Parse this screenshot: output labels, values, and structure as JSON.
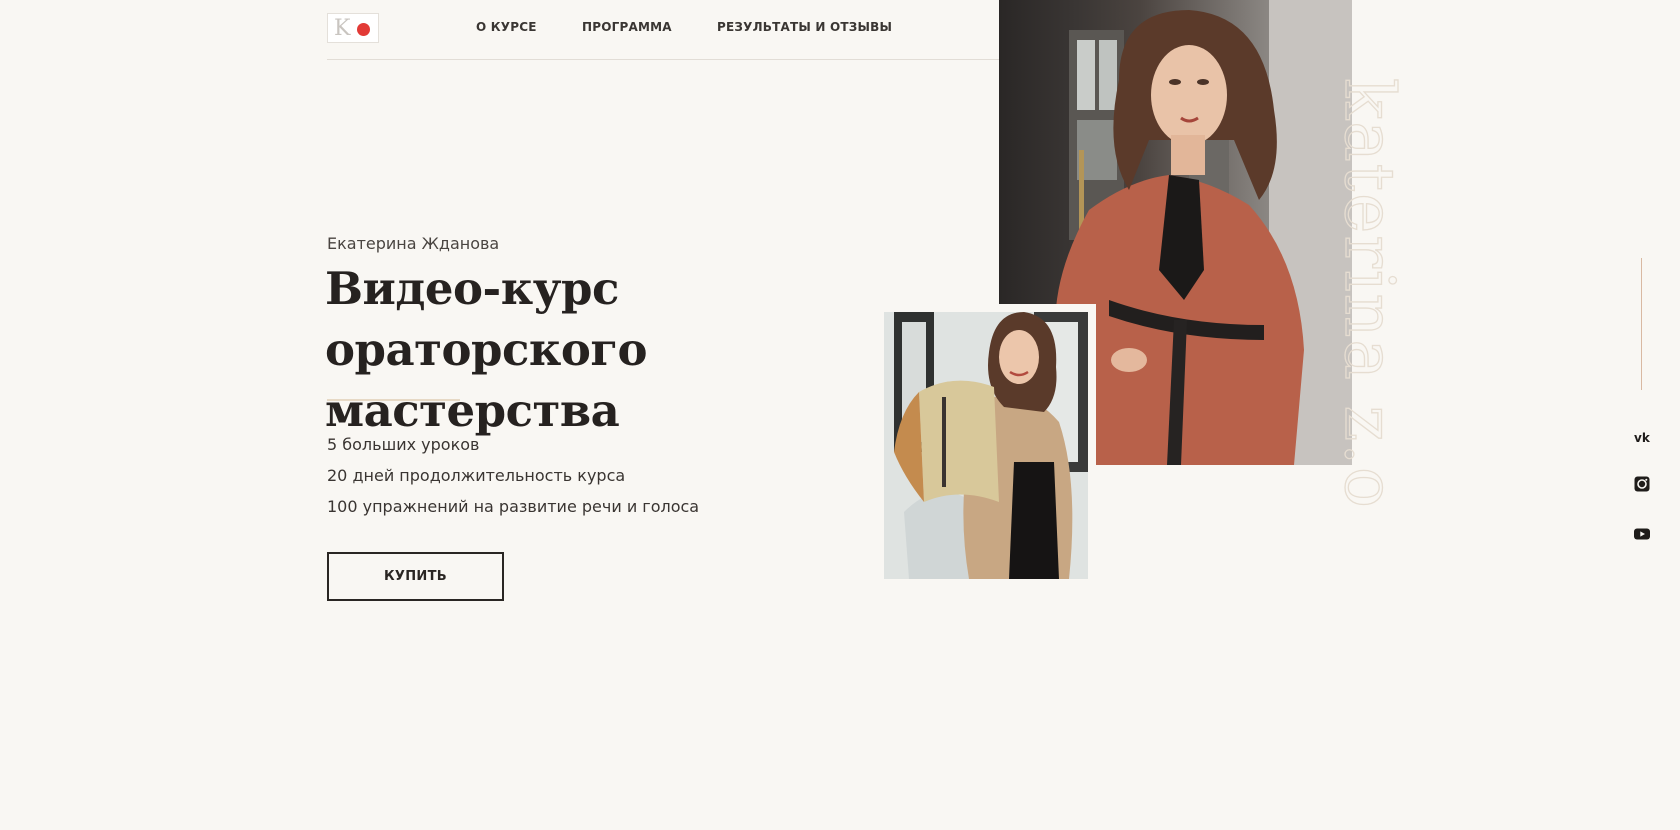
{
  "header": {
    "logo_alt": "КЖ",
    "nav": [
      {
        "label": "О КУРСЕ"
      },
      {
        "label": "ПРОГРАММА"
      },
      {
        "label": "РЕЗУЛЬТАТЫ И ОТЗЫВЫ"
      }
    ]
  },
  "hero": {
    "author": "Екатерина Жданова",
    "title": "Видео-курс ораторского мастерства",
    "facts": [
      "5 больших уроков",
      "20 дней продолжительность курса",
      "100 упражнений на развитие речи и голоса"
    ],
    "buy_label": "КУПИТЬ"
  },
  "watermark": "katerina z.o",
  "social": [
    {
      "icon": "vk-icon"
    },
    {
      "icon": "instagram-icon"
    },
    {
      "icon": "youtube-icon"
    }
  ],
  "colors": {
    "background": "#f9f7f3",
    "text": "#262220",
    "accent_line": "#e7d9c5",
    "rail_line": "#d9b9a2",
    "logo_red": "#e23a36"
  }
}
